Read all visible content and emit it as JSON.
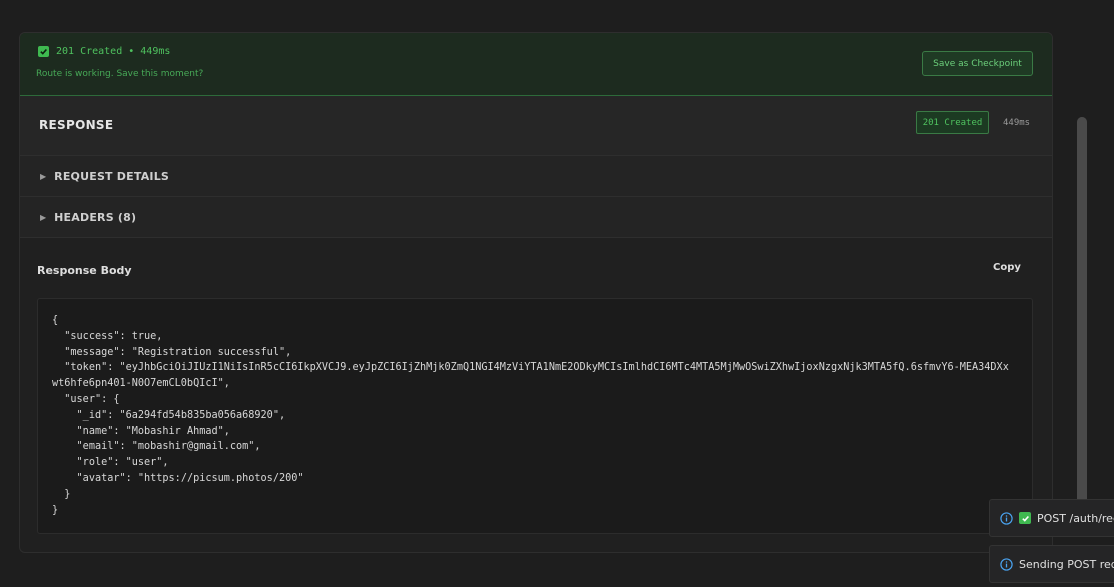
{
  "banner": {
    "status_text": "201 Created • 449ms",
    "hint": "Route is working. Save this moment?",
    "checkpoint_button": "Save as Checkpoint"
  },
  "response": {
    "title": "RESPONSE",
    "status_badge": "201 Created",
    "time": "449ms",
    "colors": {
      "success": "#3fb950",
      "success_text": "#4fc25f"
    }
  },
  "sections": {
    "request_details": "REQUEST DETAILS",
    "headers": "HEADERS (8)"
  },
  "body": {
    "label": "Response Body",
    "copy": "Copy",
    "json_text": "{\n  \"success\": true,\n  \"message\": \"Registration successful\",\n  \"token\": \"eyJhbGciOiJIUzI1NiIsInR5cCI6IkpXVCJ9.eyJpZCI6IjZhMjk0ZmQ1NGI4MzViYTA1NmE2ODkyMCIsImlhdCI6MTc4MTA5MjMwOSwiZXhwIjoxNzgxNjk3MTA5fQ.6sfmvY6-MEA34DXxwt6hfe6pn401-N0O7emCL0bQIcI\",\n  \"user\": {\n    \"_id\": \"6a294fd54b835ba056a68920\",\n    \"name\": \"Mobashir Ahmad\",\n    \"email\": \"mobashir@gmail.com\",\n    \"role\": \"user\",\n    \"avatar\": \"https://picsum.photos/200\"\n  }\n}"
  },
  "toasts": [
    {
      "icon": "info-icon",
      "text": "POST /auth/reg"
    },
    {
      "icon": "info-icon",
      "text": "Sending POST requ"
    }
  ]
}
